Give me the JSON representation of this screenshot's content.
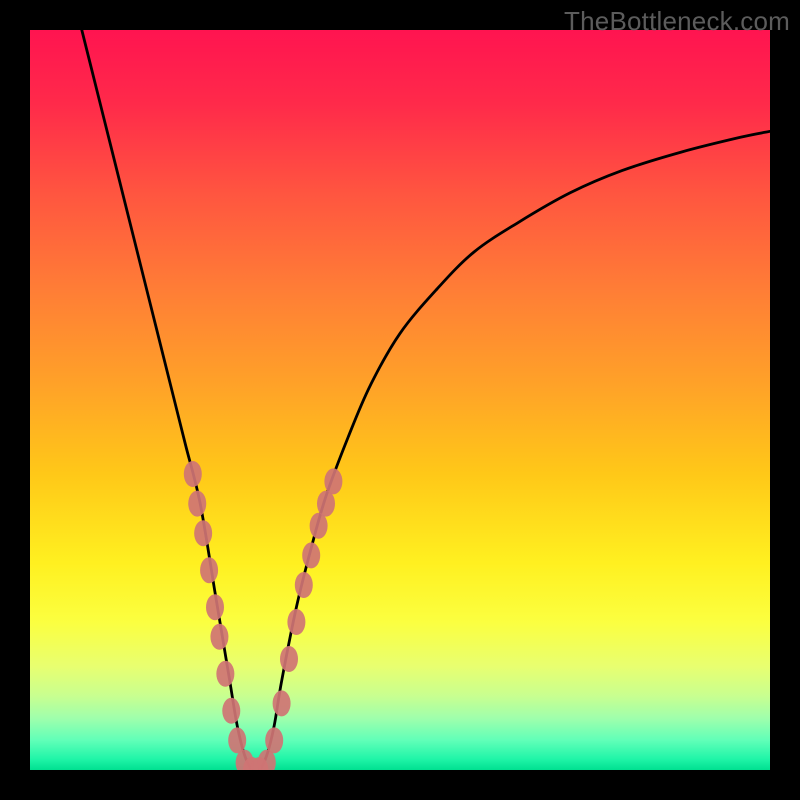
{
  "watermark": "TheBottleneck.com",
  "chart_data": {
    "type": "line",
    "title": "",
    "xlabel": "",
    "ylabel": "",
    "xlim": [
      0,
      100
    ],
    "ylim": [
      0,
      100
    ],
    "series": [
      {
        "name": "bottleneck-curve",
        "x": [
          7,
          9,
          11,
          13,
          15,
          17,
          19,
          21,
          23,
          25,
          26,
          27,
          28,
          29,
          30,
          31,
          32,
          33,
          34,
          36,
          38,
          40,
          43,
          46,
          50,
          55,
          60,
          66,
          73,
          80,
          88,
          96,
          100
        ],
        "y": [
          100,
          92,
          84,
          76,
          68,
          60,
          52,
          44,
          36,
          24,
          18,
          12,
          6,
          2,
          0,
          0,
          2,
          6,
          12,
          22,
          30,
          37,
          45,
          52,
          59,
          65,
          70,
          74,
          78,
          81,
          83.5,
          85.5,
          86.3
        ]
      }
    ],
    "markers": {
      "name": "highlight-points",
      "points": [
        {
          "x": 22.0,
          "y": 40
        },
        {
          "x": 22.6,
          "y": 36
        },
        {
          "x": 23.4,
          "y": 32
        },
        {
          "x": 24.2,
          "y": 27
        },
        {
          "x": 25.0,
          "y": 22
        },
        {
          "x": 25.6,
          "y": 18
        },
        {
          "x": 26.4,
          "y": 13
        },
        {
          "x": 27.2,
          "y": 8
        },
        {
          "x": 28.0,
          "y": 4
        },
        {
          "x": 29.0,
          "y": 1
        },
        {
          "x": 30.0,
          "y": 0
        },
        {
          "x": 31.0,
          "y": 0
        },
        {
          "x": 32.0,
          "y": 1
        },
        {
          "x": 33.0,
          "y": 4
        },
        {
          "x": 34.0,
          "y": 9
        },
        {
          "x": 35.0,
          "y": 15
        },
        {
          "x": 36.0,
          "y": 20
        },
        {
          "x": 37.0,
          "y": 25
        },
        {
          "x": 38.0,
          "y": 29
        },
        {
          "x": 39.0,
          "y": 33
        },
        {
          "x": 40.0,
          "y": 36
        },
        {
          "x": 41.0,
          "y": 39
        }
      ]
    },
    "gradient_stops": [
      {
        "offset": 0.0,
        "color": "#ff1450"
      },
      {
        "offset": 0.1,
        "color": "#ff2a4a"
      },
      {
        "offset": 0.22,
        "color": "#ff5540"
      },
      {
        "offset": 0.35,
        "color": "#ff7d36"
      },
      {
        "offset": 0.48,
        "color": "#ffa228"
      },
      {
        "offset": 0.6,
        "color": "#ffc818"
      },
      {
        "offset": 0.72,
        "color": "#fff020"
      },
      {
        "offset": 0.8,
        "color": "#fbff40"
      },
      {
        "offset": 0.86,
        "color": "#e8ff70"
      },
      {
        "offset": 0.9,
        "color": "#c8ff90"
      },
      {
        "offset": 0.93,
        "color": "#9fffac"
      },
      {
        "offset": 0.96,
        "color": "#60ffb8"
      },
      {
        "offset": 0.985,
        "color": "#20f5a8"
      },
      {
        "offset": 1.0,
        "color": "#00e090"
      }
    ]
  }
}
